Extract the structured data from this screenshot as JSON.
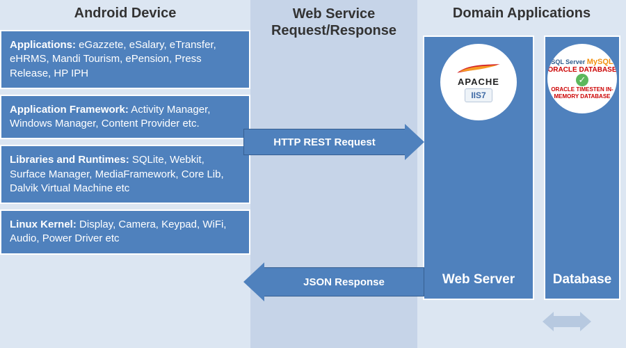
{
  "columns": {
    "android": {
      "header": "Android Device"
    },
    "middle": {
      "header": "Web Service Request/Response"
    },
    "domain": {
      "header": "Domain Applications"
    }
  },
  "android_layers": [
    {
      "title": "Applications:",
      "body": " eGazzete, eSalary, eTransfer, eHRMS, Mandi Tourism, ePension, Press Release, HP IPH"
    },
    {
      "title": "Application Framework:",
      "body": "  Activity Manager, Windows Manager, Content Provider etc."
    },
    {
      "title": "Libraries and Runtimes:",
      "body": " SQLite, Webkit, Surface Manager, MediaFramework, Core Lib, Dalvik Virtual Machine etc"
    },
    {
      "title": "Linux Kernel:",
      "body": " Display, Camera, Keypad, WiFi, Audio, Power Driver etc"
    }
  ],
  "arrows": {
    "request": "HTTP REST Request",
    "response": "JSON Response"
  },
  "domain_boxes": {
    "web_server": {
      "label": "Web Server",
      "logos": {
        "apache": "APACHE",
        "iis": "IIS7"
      }
    },
    "database": {
      "label": "Database",
      "logos": {
        "sqlserver": "SQL Server",
        "mysql": "MySQL",
        "oracle1": "ORACLE DATABASE",
        "oracle2": "ORACLE TIMESTEN IN-MEMORY DATABASE"
      }
    }
  }
}
